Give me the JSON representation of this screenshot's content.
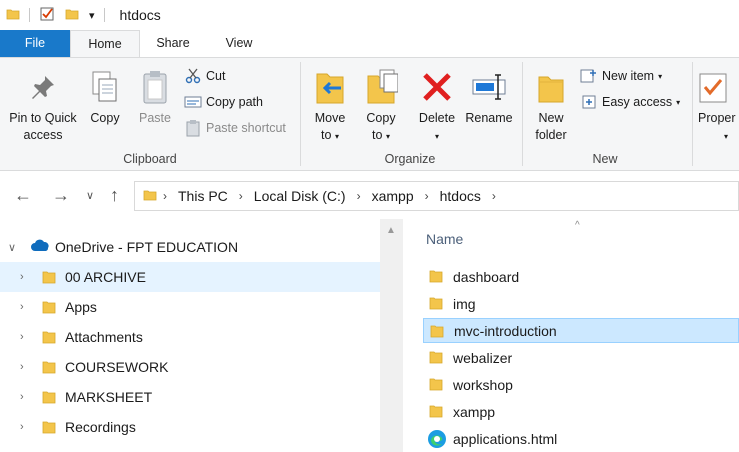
{
  "window": {
    "title": "htdocs"
  },
  "ribbon_tabs": {
    "file": "File",
    "home": "Home",
    "share": "Share",
    "view": "View"
  },
  "clipboard": {
    "pin": "Pin to Quick access",
    "pin_line1": "Pin to Quick",
    "pin_line2": "access",
    "copy": "Copy",
    "paste": "Paste",
    "cut": "Cut",
    "copy_path": "Copy path",
    "paste_shortcut": "Paste shortcut",
    "group_label": "Clipboard"
  },
  "organize": {
    "move_to_1": "Move",
    "move_to_2": "to",
    "copy_to_1": "Copy",
    "copy_to_2": "to",
    "delete": "Delete",
    "rename": "Rename",
    "group_label": "Organize"
  },
  "new": {
    "new_folder_1": "New",
    "new_folder_2": "folder",
    "new_item": "New item",
    "easy_access": "Easy access",
    "group_label": "New"
  },
  "open": {
    "properties": "Proper"
  },
  "address": {
    "crumbs": [
      "This PC",
      "Local Disk (C:)",
      "xampp",
      "htdocs"
    ]
  },
  "nav_pane": {
    "root": "OneDrive - FPT EDUCATION",
    "items": [
      "00 ARCHIVE",
      "Apps",
      "Attachments",
      "COURSEWORK",
      "MARKSHEET",
      "Recordings"
    ]
  },
  "content": {
    "column_name": "Name",
    "files": [
      "dashboard",
      "img",
      "mvc-introduction",
      "webalizer",
      "workshop",
      "xampp",
      "applications.html"
    ]
  },
  "colors": {
    "file_tab": "#1979ca",
    "selection": "#cce8ff",
    "folder": "#f3c54b"
  }
}
